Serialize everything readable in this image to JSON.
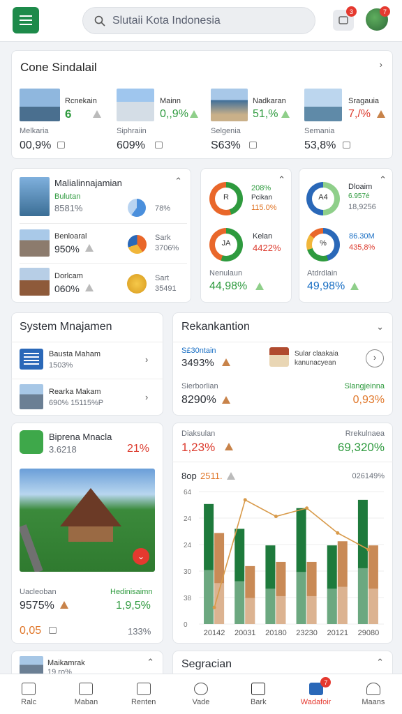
{
  "header": {
    "search_placeholder": "Slutaii Kota Indonesia",
    "notif_count": "3",
    "avatar_count": "7"
  },
  "summary": {
    "title": "Cone Sindalail",
    "items": [
      {
        "name": "Rcnekain",
        "value": "6",
        "label": "Melkaria",
        "pct": "00,9%"
      },
      {
        "name": "Mainn",
        "value": "0,,9%",
        "label": "Siphraiin",
        "pct": "609%"
      },
      {
        "name": "Nadkaran",
        "value": "51,%",
        "label": "Selgenia",
        "pct": "S63%"
      },
      {
        "name": "Sragauia",
        "value": "7,/%",
        "label": "Semania",
        "pct": "53,8%"
      }
    ]
  },
  "mgmt": {
    "title": "Malialinnajamian",
    "rows": [
      {
        "name": "Bulutan",
        "value": "8581%",
        "side": "78%"
      },
      {
        "name": "Benloaral",
        "value": "950%",
        "side_label": "Sark",
        "side": "3706%"
      },
      {
        "name": "Dorlcam",
        "value": "060%",
        "side_label": "Sart",
        "side": "35491"
      }
    ]
  },
  "rings1": {
    "r1": {
      "center": "R",
      "l1": "208%",
      "l2": "Pcikan",
      "l3": "115.0%"
    },
    "r2": {
      "center": "JA",
      "l1": "Kelan",
      "l2": "4422%"
    },
    "foot_label": "Nenulaun",
    "foot_value": "44,98%"
  },
  "rings2": {
    "r1": {
      "center": "A4",
      "l1": "Dloaim",
      "l2": "6.957é",
      "l3": "18,9256"
    },
    "r2": {
      "center": "%",
      "l1": "86.30M",
      "l2": "435,8%"
    },
    "foot_label": "Atdrdlain",
    "foot_value": "49,98%"
  },
  "system": {
    "title": "System Mnajamen",
    "rows": [
      {
        "name": "Bausta Maham",
        "value": "1503%"
      },
      {
        "name": "Rearka Makam",
        "value": "690% 15115%P"
      }
    ]
  },
  "rekan": {
    "title": "Rekankantion",
    "top_label": "S£30ntain",
    "top_value": "3493%",
    "note1": "Sular claakaia",
    "note2": "kanunacyean",
    "bl_label": "Sierborlian",
    "bl_value": "8290%",
    "br_label": "Slangjeinna",
    "br_value": "0,93%"
  },
  "feature": {
    "title": "Biprena Mnacla",
    "sub": "3.6218",
    "pct": "21%",
    "l1": "Uacleoban",
    "v1": "9575%",
    "l2": "Hedinisaimn",
    "v2": "1,9,5%",
    "v3": "0,05",
    "v4": "133%"
  },
  "chartcard": {
    "tl_label": "Diaksulan",
    "tl_value": "1,23%",
    "tr_label": "Rrekulnaea",
    "tr_value": "69,320%",
    "sub_label": "8op",
    "sub_value": "2511.",
    "sub_right": "026149%"
  },
  "chart_data": {
    "type": "bar",
    "categories": [
      "20142",
      "20031",
      "20180",
      "23230",
      "20121",
      "29080"
    ],
    "series": [
      {
        "values": [
          29,
          23,
          19,
          28,
          19,
          30
        ],
        "color": "#1e7a3c"
      },
      {
        "values": [
          22,
          14,
          15,
          15,
          20,
          19
        ],
        "color": "#c98a56"
      }
    ],
    "line": [
      4,
      30,
      26,
      28,
      22,
      18
    ],
    "ytick_labels": [
      "64",
      "24",
      "24",
      "30",
      "38",
      "0"
    ],
    "ylim": [
      0,
      32
    ]
  },
  "bottom_cards": {
    "left": "Maikamrak",
    "left_sub": "19 ro%",
    "right": "Segracian"
  },
  "nav": [
    {
      "label": "Ralc"
    },
    {
      "label": "Maban"
    },
    {
      "label": "Renten"
    },
    {
      "label": "Vade"
    },
    {
      "label": "Bark"
    },
    {
      "label": "Wadafoir",
      "badge": "7"
    },
    {
      "label": "Maans"
    }
  ]
}
